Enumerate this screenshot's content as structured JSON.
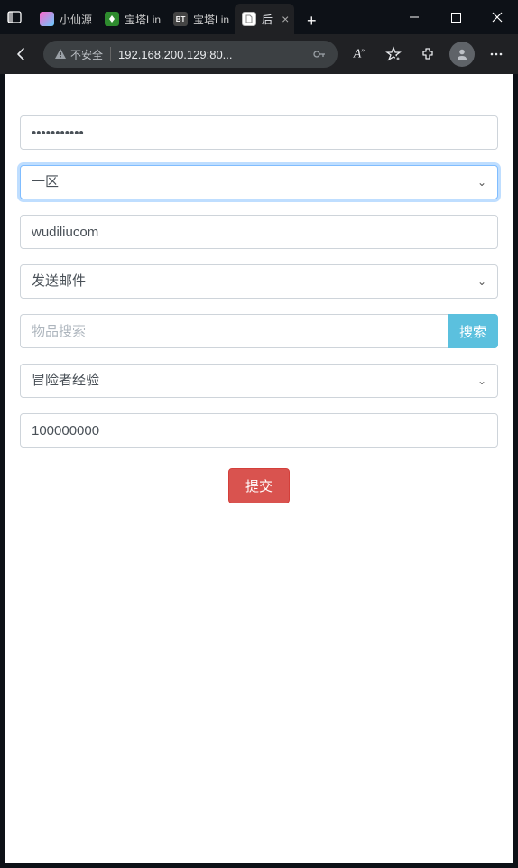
{
  "titlebar": {
    "tabs": [
      {
        "favicon": "fav-xx",
        "title": "小仙源"
      },
      {
        "favicon": "fav-bt1",
        "title": "宝塔Lin"
      },
      {
        "favicon": "fav-bt2",
        "fav_text": "BT",
        "title": "宝塔Lin"
      },
      {
        "favicon": "fav-page",
        "title": "后",
        "active": true
      }
    ],
    "new_tab": "+"
  },
  "addrbar": {
    "not_secure": "不安全",
    "url": "192.168.200.129:80..."
  },
  "form": {
    "password_value": "•••••••••••",
    "region_selected": "一区",
    "username_value": "wudiliucom",
    "action_selected": "发送邮件",
    "item_search_placeholder": "物品搜索",
    "item_search_value": "",
    "search_btn": "搜索",
    "category_selected": "冒险者经验",
    "amount_value": "100000000",
    "submit": "提交"
  }
}
